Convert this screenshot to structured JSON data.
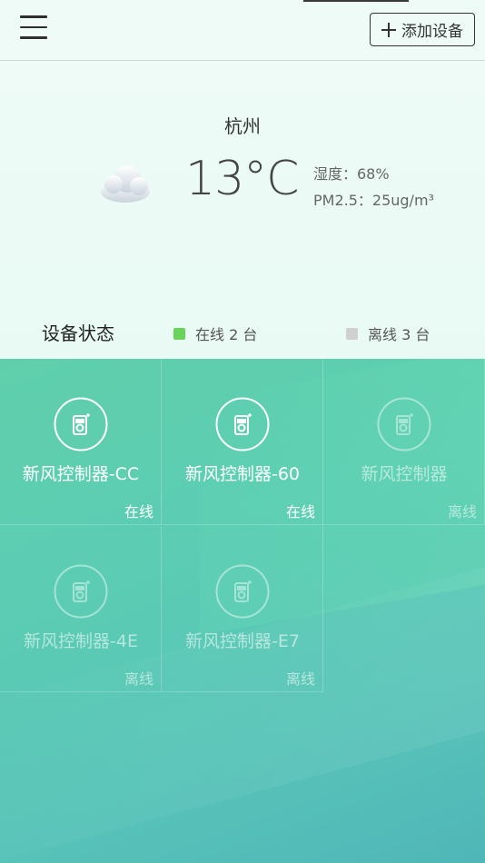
{
  "header": {
    "add_device_label": "添加设备"
  },
  "weather": {
    "city": "杭州",
    "temperature": "13°C",
    "humidity": "湿度：68%",
    "pm25": "PM2.5：25ug/m³",
    "condition_icon": "cloud-icon"
  },
  "status": {
    "title": "设备状态",
    "online_label": "在线 2 台",
    "offline_label": "离线 3 台",
    "online_color": "#6ad45a",
    "offline_color": "#d0d0d0"
  },
  "devices": [
    {
      "name": "新风控制器-CC",
      "state": "在线",
      "online": true
    },
    {
      "name": "新风控制器-60",
      "state": "在线",
      "online": true
    },
    {
      "name": "新风控制器",
      "state": "离线",
      "online": false
    },
    {
      "name": "新风控制器-4E",
      "state": "离线",
      "online": false
    },
    {
      "name": "新风控制器-E7",
      "state": "离线",
      "online": false
    }
  ]
}
